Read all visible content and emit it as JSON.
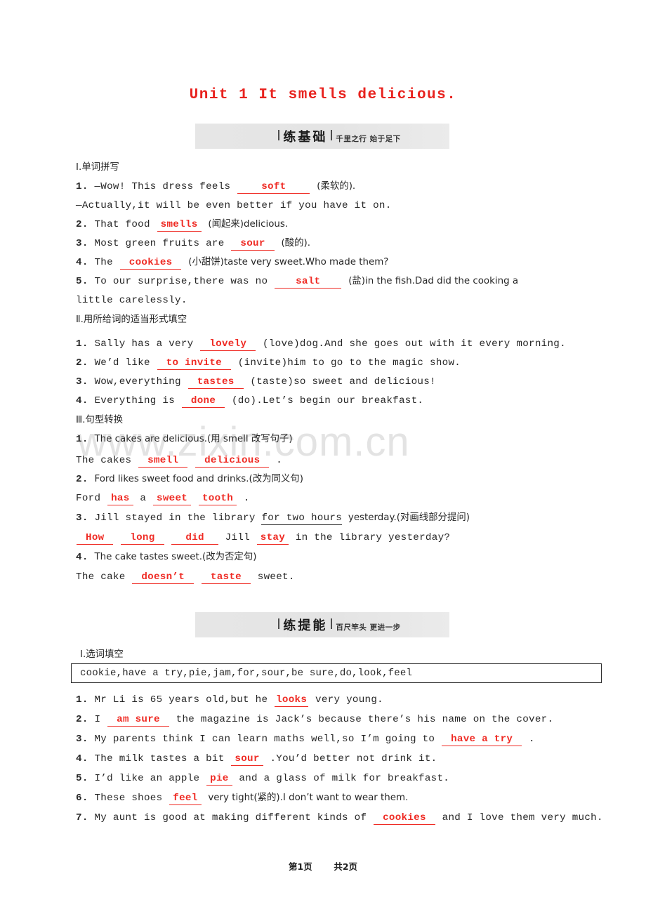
{
  "document": {
    "title": "Unit 1  It smells delicious.",
    "title_color": "#e8221e",
    "watermark": "www.zixin.com.cn",
    "footer": {
      "current": "第1页",
      "total": "共2页"
    }
  },
  "banners": [
    {
      "main": "练基础",
      "sub": "千里之行  始于足下"
    },
    {
      "main": "练提能",
      "sub": "百尺竿头  更进一步"
    }
  ],
  "section1": {
    "part1": {
      "heading": "Ⅰ.单词拼写",
      "items": [
        {
          "num": "1.",
          "pre": "—Wow! This dress feels",
          "answer": "soft",
          "post": "(柔软的)."
        },
        {
          "cont": "—Actually,it will be even better if you have it on."
        },
        {
          "num": "2.",
          "pre": "That food",
          "answer": "smells",
          "post": "(闻起来)delicious."
        },
        {
          "num": "3.",
          "pre": "Most green fruits are",
          "answer": "sour",
          "post": "(酸的)."
        },
        {
          "num": "4.",
          "pre": "The",
          "answer": "cookies",
          "post": "(小甜饼)taste very sweet.Who made them?"
        },
        {
          "num": "5.",
          "pre": "To our surprise,there was no",
          "answer": "salt",
          "post": "(盐)in the fish.Dad did the cooking a"
        },
        {
          "cont": "little carelessly."
        }
      ]
    },
    "part2": {
      "heading": "Ⅱ.用所给词的适当形式填空",
      "items": [
        {
          "num": "1.",
          "pre": "Sally has a very",
          "answer": "lovely",
          "post": "(love)dog.And she goes out with it every morning."
        },
        {
          "num": "2.",
          "pre": "We’d like",
          "answer": "to invite",
          "post": "(invite)him to go to the magic show."
        },
        {
          "num": "3.",
          "pre": "Wow,everything",
          "answer": "tastes",
          "post": "(taste)so sweet and delicious!"
        },
        {
          "num": "4.",
          "pre": "Everything is",
          "answer": "done",
          "post": "(do).Let’s begin our breakfast."
        }
      ]
    },
    "part3": {
      "heading": "Ⅲ.句型转换",
      "items": [
        {
          "num": "1.",
          "question": "The cakes are delicious.(用 smell 改写句子)",
          "answer_pre": "The cakes",
          "answers": [
            "smell",
            "delicious"
          ],
          "answer_post": "."
        },
        {
          "num": "2.",
          "question": "Ford likes sweet food and drinks.(改为同义句)",
          "answer_pre": "Ford",
          "answers": [
            "has",
            "sweet",
            "tooth"
          ],
          "mid": "a",
          "answer_post": "."
        },
        {
          "num": "3.",
          "question_pre": "Jill stayed in the library",
          "question_underlined": "for two hours",
          "question_post": "yesterday.(对画线部分提问)",
          "answers": [
            "How",
            "long",
            "did",
            "stay"
          ],
          "mid": "Jill",
          "answer_post": "in the library yesterday?"
        },
        {
          "num": "4.",
          "question": "The cake tastes sweet.(改为否定句)",
          "answer_pre": "The cake",
          "answers": [
            "doesn’t",
            "taste"
          ],
          "answer_post": "sweet."
        }
      ]
    }
  },
  "section2": {
    "part1": {
      "heading": "Ⅰ.选词填空",
      "wordbank": "cookie,have a try,pie,jam,for,sour,be sure,do,look,feel",
      "items": [
        {
          "num": "1.",
          "pre": "Mr Li is 65 years old,but he",
          "answer": "looks",
          "post": "very young.",
          "inline": true
        },
        {
          "num": "2.",
          "pre": "I",
          "answer": "am sure",
          "post": "the magazine is Jack’s because there’s his name on the cover."
        },
        {
          "num": "3.",
          "pre": "My parents think I can learn maths well,so I’m going to",
          "answer": "have a try",
          "post": "."
        },
        {
          "num": "4.",
          "pre": "The milk tastes a bit",
          "answer": "sour",
          "post": ".You’d better not drink it."
        },
        {
          "num": "5.",
          "pre": "I’d like an apple",
          "answer": "pie",
          "post": "and a glass of milk for breakfast."
        },
        {
          "num": "6.",
          "pre": "These shoes",
          "answer": "feel",
          "post": "very tight(紧的).I don’t want to wear them."
        },
        {
          "num": "7.",
          "pre": "My aunt is good at making different kinds of",
          "answer": "cookies",
          "post": "and I love them very much."
        }
      ]
    }
  }
}
